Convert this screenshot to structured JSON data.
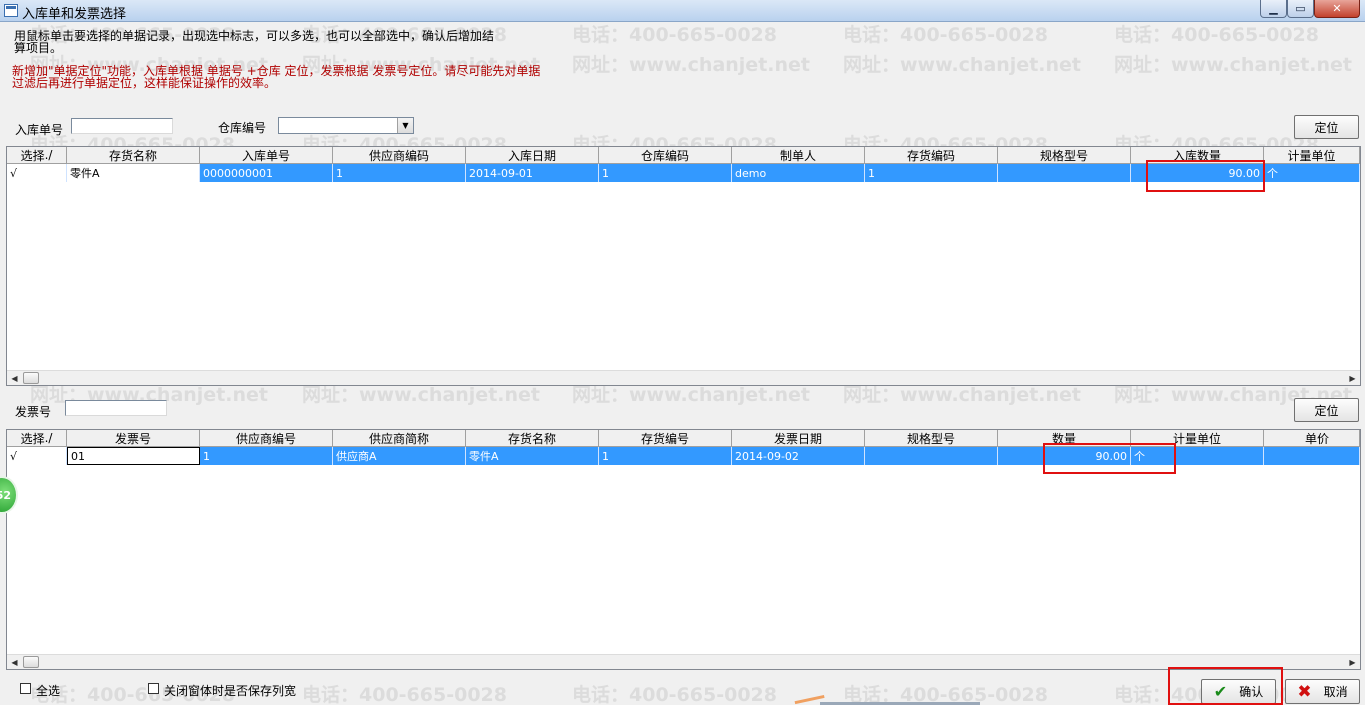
{
  "window": {
    "title": "入库单和发票选择",
    "minimize_glyph": "▁",
    "maximize_glyph": "▭",
    "close_glyph": "✕"
  },
  "instructions": "用鼠标单击要选择的单据记录，出现选中标志，可以多选，也可以全部选中，确认后增加结算项目。",
  "notice": "新增加\"单据定位\"功能，入库单根据 单据号 +仓库 定位，发票根据 发票号定位。请尽可能先对单据过滤后再进行单据定位，这样能保证操作的效率。",
  "watermark": {
    "phone": "电话：400-665-0028",
    "site": "网址：www.chanjet.net"
  },
  "receipt_filter": {
    "receipt_no_label": "入库单号",
    "receipt_no_value": "",
    "warehouse_label": "仓库编号",
    "warehouse_value": "",
    "locate_button": "定位"
  },
  "receipt_grid": {
    "columns": [
      "选择",
      "存货名称",
      "入库单号",
      "供应商编码",
      "入库日期",
      "仓库编码",
      "制单人",
      "存货编码",
      "规格型号",
      "入库数量",
      "计量单位"
    ],
    "rows": [
      {
        "select": "√",
        "item_name": "零件A",
        "receipt_no": "0000000001",
        "supplier_code": "1",
        "receipt_date": "2014-09-01",
        "warehouse_code": "1",
        "creator": "demo",
        "item_code": "1",
        "spec": "",
        "quantity": "90.00",
        "unit": "个"
      }
    ]
  },
  "invoice_filter": {
    "invoice_no_label": "发票号",
    "invoice_no_value": "",
    "locate_button": "定位"
  },
  "invoice_grid": {
    "columns": [
      "选择",
      "发票号",
      "供应商编号",
      "供应商简称",
      "存货名称",
      "存货编号",
      "发票日期",
      "规格型号",
      "数量",
      "计量单位",
      "单价"
    ],
    "rows": [
      {
        "select": "√",
        "invoice_no": "01",
        "supplier_no": "1",
        "supplier_short": "供应商A",
        "item_name": "零件A",
        "item_no": "1",
        "invoice_date": "2014-09-02",
        "spec": "",
        "quantity": "90.00",
        "unit": "个",
        "price": ""
      }
    ]
  },
  "footer": {
    "select_all_label": "全选",
    "save_width_label": "关闭窗体时是否保存列宽",
    "confirm_button": "确认",
    "cancel_button": "取消"
  },
  "badge_text": "52",
  "colors": {
    "selection": "#3399ff",
    "highlight_box": "#e01010",
    "notice_text": "#b00000"
  }
}
